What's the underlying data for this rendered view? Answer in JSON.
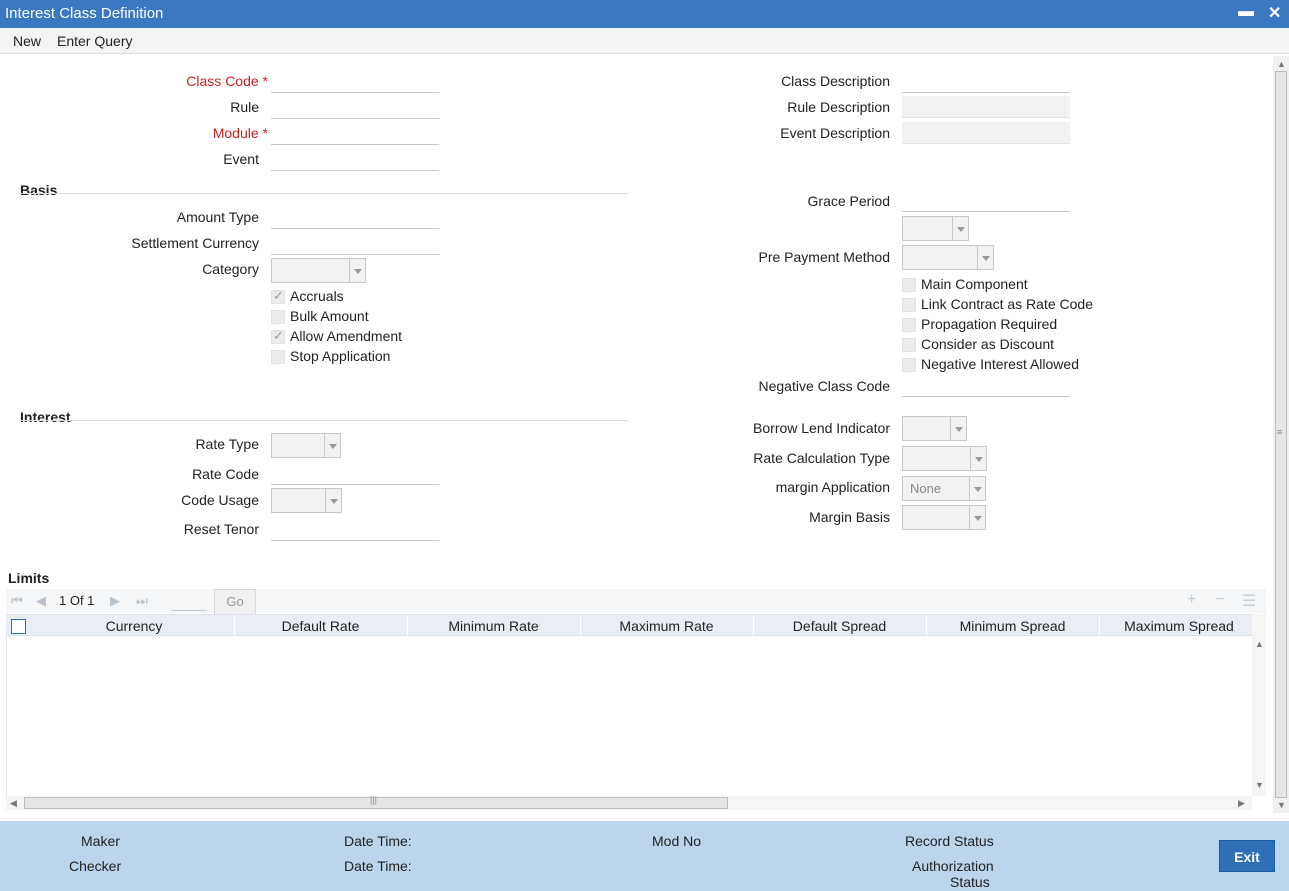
{
  "window": {
    "title": "Interest Class Definition",
    "minimize": "▬",
    "close": "✕"
  },
  "menu": {
    "new": "New",
    "enter_query": "Enter Query"
  },
  "header": {
    "class_code": "Class Code *",
    "rule": "Rule",
    "module": "Module *",
    "event": "Event",
    "class_description": "Class Description",
    "rule_description": "Rule Description",
    "event_description": "Event Description"
  },
  "basis": {
    "title": "Basis",
    "amount_type": "Amount Type",
    "settlement_currency": "Settlement Currency",
    "category": "Category",
    "checkboxes": {
      "accruals": "Accruals",
      "bulk_amount": "Bulk Amount",
      "allow_amendment": "Allow Amendment",
      "stop_application": "Stop Application"
    }
  },
  "right_panel": {
    "grace_period": "Grace Period",
    "pre_payment_method": "Pre Payment Method",
    "checkboxes": {
      "main_component": "Main Component",
      "link_contract": "Link Contract as Rate Code",
      "propagation_required": "Propagation Required",
      "consider_as_discount": "Consider as Discount",
      "negative_interest": "Negative Interest Allowed"
    },
    "negative_class_code": "Negative Class Code",
    "borrow_lend_indicator": "Borrow Lend Indicator",
    "rate_calculation_type": "Rate Calculation Type",
    "margin_application": "margin Application",
    "margin_application_value": "None",
    "margin_basis": "Margin Basis"
  },
  "interest": {
    "title": "Interest",
    "rate_type": "Rate Type",
    "rate_code": "Rate Code",
    "code_usage": "Code Usage",
    "reset_tenor": "Reset Tenor"
  },
  "limits": {
    "title": "Limits",
    "pagination": "1 Of 1",
    "go": "Go",
    "columns": [
      "Currency",
      "Default Rate",
      "Minimum Rate",
      "Maximum Rate",
      "Default Spread",
      "Minimum Spread",
      "Maximum Spread"
    ],
    "rows": []
  },
  "footer": {
    "maker": "Maker",
    "checker": "Checker",
    "date_time_1": "Date Time:",
    "date_time_2": "Date Time:",
    "mod_no": "Mod No",
    "record_status": "Record Status",
    "authorization": "Authorization",
    "status": "Status",
    "exit": "Exit"
  },
  "colors": {
    "titlebar": "#3a78c2",
    "required": "#cc2020",
    "footer": "#bcd5ea",
    "exit_button": "#2f6fb5"
  }
}
